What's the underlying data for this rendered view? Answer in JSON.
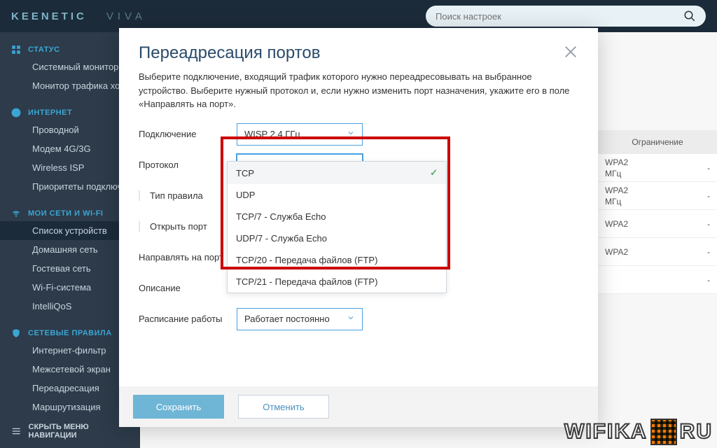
{
  "brand": {
    "name": "KEENETIC",
    "model": "VIVA"
  },
  "search": {
    "placeholder": "Поиск настроек"
  },
  "sidebar": {
    "groups": [
      {
        "title": "СТАТУС",
        "items": [
          "Системный монитор",
          "Монитор трафика хостов"
        ]
      },
      {
        "title": "ИНТЕРНЕТ",
        "items": [
          "Проводной",
          "Модем 4G/3G",
          "Wireless ISP",
          "Приоритеты подключений"
        ]
      },
      {
        "title": "МОИ СЕТИ И WI-FI",
        "items": [
          "Список устройств",
          "Домашняя сеть",
          "Гостевая сеть",
          "Wi-Fi-система",
          "IntelliQoS"
        ]
      },
      {
        "title": "СЕТЕВЫЕ ПРАВИЛА",
        "items": [
          "Интернет-фильтр",
          "Межсетевой экран",
          "Переадресация",
          "Маршрутизация"
        ]
      }
    ],
    "active": "Список устройств",
    "collapse": "СКРЫТЬ МЕНЮ НАВИГАЦИИ"
  },
  "bgtable": {
    "head": "Ограничение",
    "rows": [
      {
        "a": "WPA2",
        "b": "МГц",
        "c": "-"
      },
      {
        "a": "WPA2",
        "b": "МГц",
        "c": "-"
      },
      {
        "a": "WPA2",
        "b": "",
        "c": "-"
      },
      {
        "a": "WPA2",
        "b": "",
        "c": "-"
      },
      {
        "a": "",
        "b": "",
        "c": "-"
      }
    ]
  },
  "modal": {
    "title": "Переадресация портов",
    "desc": "Выберите подключение, входящий трафик которого нужно переадресовывать на выбранное устройство. Выберите нужный протокол и, если нужно изменить порт назначения, укажите его в поле «Направлять на порт».",
    "labels": {
      "connection": "Подключение",
      "protocol": "Протокол",
      "rule_type": "Тип правила",
      "open_port": "Открыть порт",
      "forward_to": "Направлять на порт",
      "description": "Описание",
      "schedule": "Расписание работы"
    },
    "values": {
      "connection": "WISP 2,4 ГГц",
      "protocol": "TCP",
      "schedule": "Работает постоянно"
    },
    "dropdown": [
      "TCP",
      "UDP",
      "TCP/7 - Служба Echo",
      "UDP/7 - Служба Echo",
      "TCP/20 - Передача файлов (FTP)",
      "TCP/21 - Передача файлов (FTP)"
    ],
    "buttons": {
      "save": "Сохранить",
      "cancel": "Отменить"
    }
  },
  "watermark": {
    "a": "WIFIKA",
    "b": "RU"
  }
}
